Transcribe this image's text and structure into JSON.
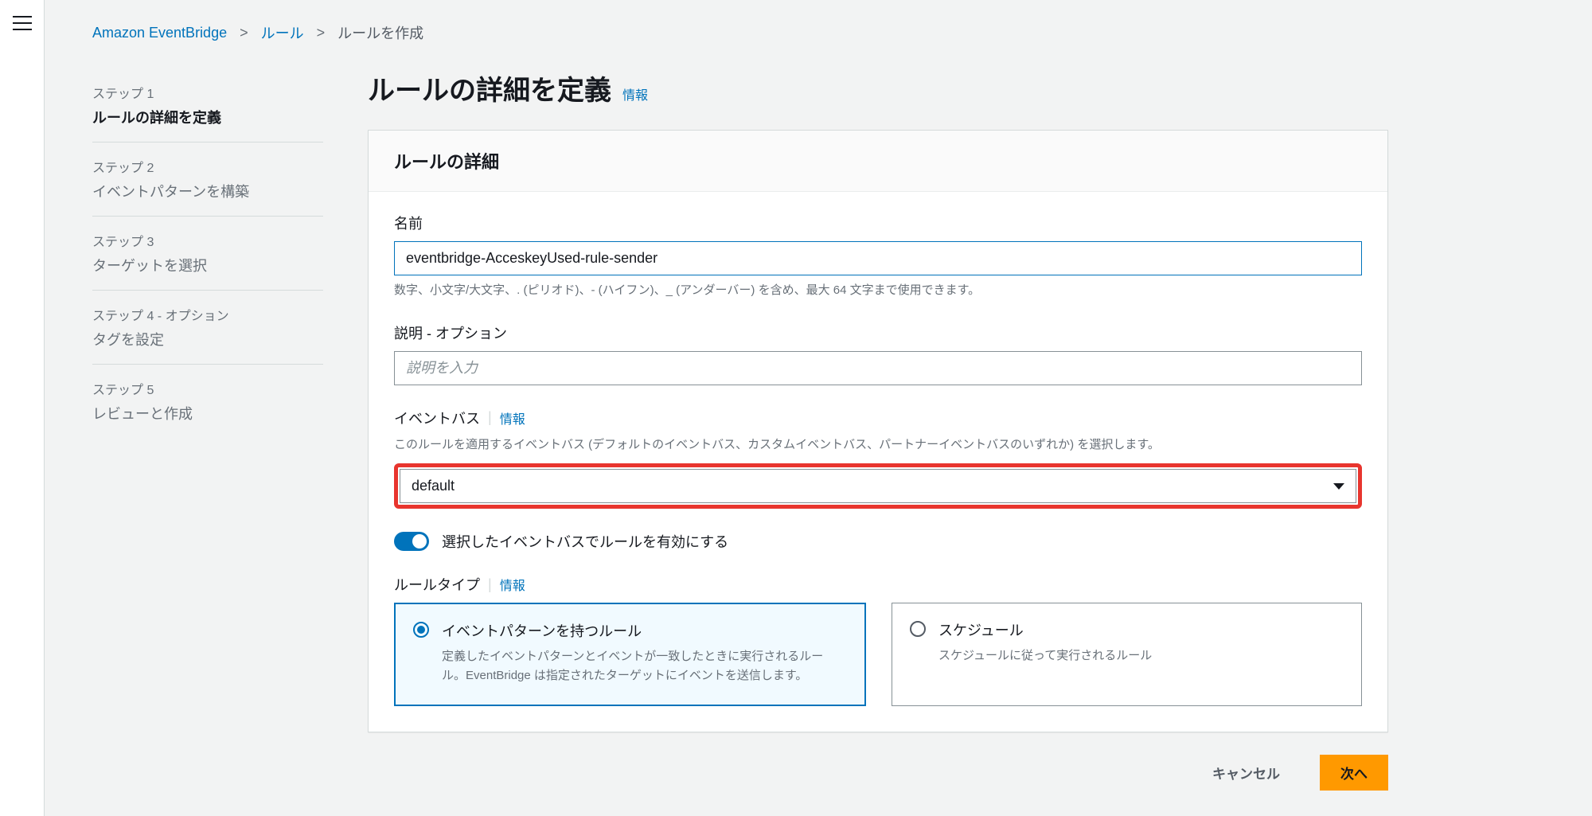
{
  "breadcrumbs": {
    "root": "Amazon EventBridge",
    "rules": "ルール",
    "current": "ルールを作成"
  },
  "steps": [
    {
      "label": "ステップ 1",
      "title": "ルールの詳細を定義",
      "active": true
    },
    {
      "label": "ステップ 2",
      "title": "イベントパターンを構築",
      "active": false
    },
    {
      "label": "ステップ 3",
      "title": "ターゲットを選択",
      "active": false
    },
    {
      "label": "ステップ 4 - オプション",
      "title": "タグを設定",
      "active": false
    },
    {
      "label": "ステップ 5",
      "title": "レビューと作成",
      "active": false
    }
  ],
  "page_title": "ルールの詳細を定義",
  "info_label": "情報",
  "panel": {
    "header": "ルールの詳細",
    "name": {
      "label": "名前",
      "value": "eventbridge-AcceskeyUsed-rule-sender",
      "help": "数字、小文字/大文字、. (ピリオド)、- (ハイフン)、_ (アンダーバー) を含め、最大 64 文字まで使用できます。"
    },
    "description": {
      "label": "説明 - オプション",
      "placeholder": "説明を入力"
    },
    "event_bus": {
      "label": "イベントバス",
      "help": "このルールを適用するイベントバス (デフォルトのイベントバス、カスタムイベントバス、パートナーイベントバスのいずれか) を選択します。",
      "value": "default"
    },
    "toggle": {
      "label": "選択したイベントバスでルールを有効にする"
    },
    "rule_type": {
      "label": "ルールタイプ",
      "tiles": [
        {
          "title": "イベントパターンを持つルール",
          "desc": "定義したイベントパターンとイベントが一致したときに実行されるルール。EventBridge は指定されたターゲットにイベントを送信します。",
          "selected": true
        },
        {
          "title": "スケジュール",
          "desc": "スケジュールに従って実行されるルール",
          "selected": false
        }
      ]
    }
  },
  "footer": {
    "cancel": "キャンセル",
    "next": "次へ"
  }
}
